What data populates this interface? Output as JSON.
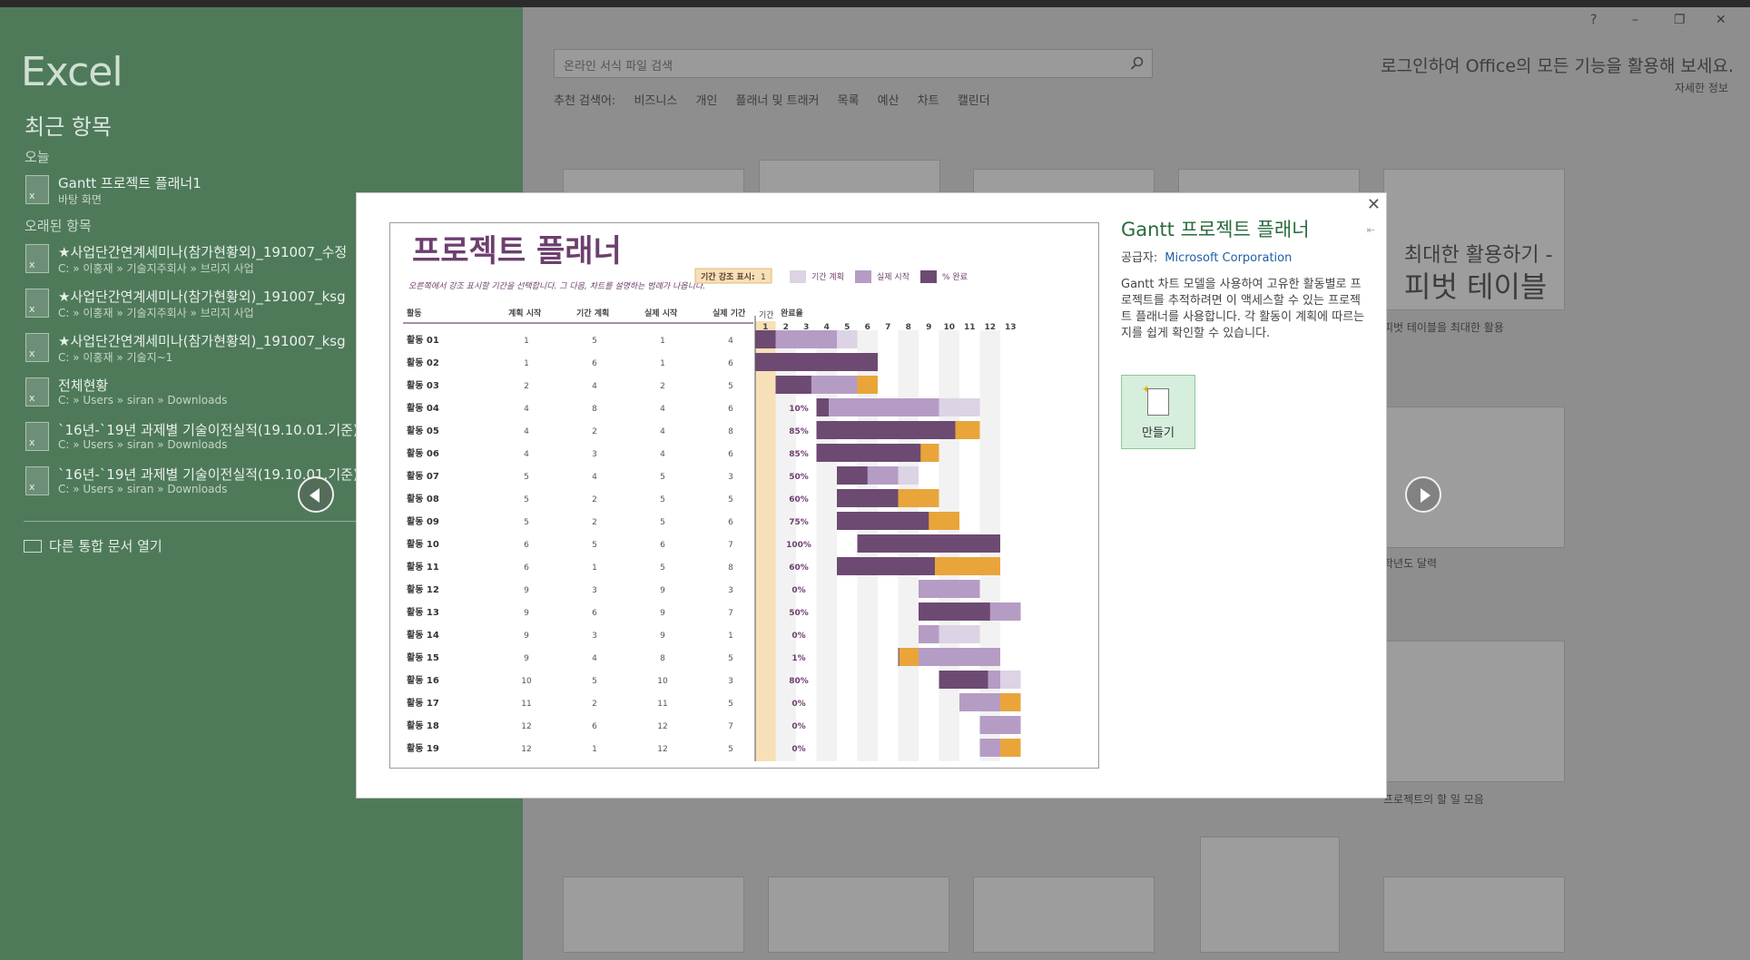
{
  "left": {
    "app_name": "Excel",
    "recent_title": "최근 항목",
    "today_label": "오늘",
    "older_label": "오래된 항목",
    "today_files": [
      {
        "name": "Gantt 프로젝트 플래너1",
        "path": "바탕 화면"
      }
    ],
    "older_files": [
      {
        "name": "★사업단간연계세미나(참가현황외)_191007_수정",
        "path": "C: » 이홍재 » 기술지주회사 » 브리지 사업"
      },
      {
        "name": "★사업단간연계세미나(참가현황외)_191007_ksg",
        "path": "C: » 이홍재 » 기술지주회사 » 브리지 사업"
      },
      {
        "name": "★사업단간연계세미나(참가현황외)_191007_ksg",
        "path": "C: » 이홍재 » 기술지~1"
      },
      {
        "name": "전체현황",
        "path": "C: » Users » siran » Downloads"
      },
      {
        "name": "`16년-`19년 과제별 기술이전실적(19.10.01.기준)_(",
        "path": "C: » Users » siran » Downloads"
      },
      {
        "name": "`16년-`19년 과제별 기술이전실적(19.10.01.기준)",
        "path": "C: » Users » siran » Downloads"
      }
    ],
    "open_other": "다른 통합 문서 열기"
  },
  "right": {
    "window_controls": [
      "?",
      "–",
      "❐",
      "✕"
    ],
    "search_placeholder": "온라인 서식 파일 검색",
    "suggested_label": "추천 검색어:",
    "suggested": [
      "비즈니스",
      "개인",
      "플래너 및 트래커",
      "목록",
      "예산",
      "차트",
      "캘린더"
    ],
    "signin": "로그인하여 Office의 모든 기능을 활용해 보세요.",
    "details": "자세한 정보",
    "tile_captions": [
      "피벗 테이블을 최대한 활용",
      "학년도 달력",
      "프로젝트의 할 일 모음"
    ],
    "pivot_tile": {
      "line1": "최대한 활용하기 -",
      "line2": "피벗 테이블"
    }
  },
  "dialog": {
    "title": "Gantt 프로젝트 플래너",
    "publisher_label": "공급자:",
    "publisher": "Microsoft Corporation",
    "description": "Gantt 차트 모델을 사용하여 고유한 활동별로 프로젝트를 추적하려면 이 액세스할 수 있는 프로젝트 플래너를 사용합니다. 각 활동이 계획에 따르는지를 쉽게 확인할 수 있습니다.",
    "create_label": "만들기",
    "close": "✕"
  },
  "planner": {
    "title": "프로젝트 플래너",
    "subtitle": "오른쪽에서 강조 표시할 기간을 선택합니다. 그 다음, 차트를 설명하는 범례가 나옵니다.",
    "highlight_label": "기간 강조 표시:",
    "highlight_value": "1",
    "legend": [
      {
        "label": "기간 계획",
        "color": "#dcd3e4"
      },
      {
        "label": "실제 시작",
        "color": "#b59cc4"
      },
      {
        "label": "% 완료",
        "color": "#6d4a72"
      }
    ],
    "period_label": "기간",
    "headers": [
      "활동",
      "계획 시작",
      "기간 계획",
      "실제 시작",
      "실제 기간",
      "완료율"
    ],
    "periods": [
      "1",
      "2",
      "3",
      "4",
      "5",
      "6",
      "7",
      "8",
      "9",
      "10",
      "11",
      "12",
      "13"
    ],
    "rows": [
      {
        "name": "활동 01",
        "plan_start": 1,
        "plan_dur": 5,
        "act_start": 1,
        "act_dur": 4,
        "pct": "25%"
      },
      {
        "name": "활동 02",
        "plan_start": 1,
        "plan_dur": 6,
        "act_start": 1,
        "act_dur": 6,
        "pct": "100%"
      },
      {
        "name": "활동 03",
        "plan_start": 2,
        "plan_dur": 4,
        "act_start": 2,
        "act_dur": 5,
        "pct": "35%"
      },
      {
        "name": "활동 04",
        "plan_start": 4,
        "plan_dur": 8,
        "act_start": 4,
        "act_dur": 6,
        "pct": "10%"
      },
      {
        "name": "활동 05",
        "plan_start": 4,
        "plan_dur": 2,
        "act_start": 4,
        "act_dur": 8,
        "pct": "85%"
      },
      {
        "name": "활동 06",
        "plan_start": 4,
        "plan_dur": 3,
        "act_start": 4,
        "act_dur": 6,
        "pct": "85%"
      },
      {
        "name": "활동 07",
        "plan_start": 5,
        "plan_dur": 4,
        "act_start": 5,
        "act_dur": 3,
        "pct": "50%"
      },
      {
        "name": "활동 08",
        "plan_start": 5,
        "plan_dur": 2,
        "act_start": 5,
        "act_dur": 5,
        "pct": "60%"
      },
      {
        "name": "활동 09",
        "plan_start": 5,
        "plan_dur": 2,
        "act_start": 5,
        "act_dur": 6,
        "pct": "75%"
      },
      {
        "name": "활동 10",
        "plan_start": 6,
        "plan_dur": 5,
        "act_start": 6,
        "act_dur": 7,
        "pct": "100%"
      },
      {
        "name": "활동 11",
        "plan_start": 6,
        "plan_dur": 1,
        "act_start": 5,
        "act_dur": 8,
        "pct": "60%"
      },
      {
        "name": "활동 12",
        "plan_start": 9,
        "plan_dur": 3,
        "act_start": 9,
        "act_dur": 3,
        "pct": "0%"
      },
      {
        "name": "활동 13",
        "plan_start": 9,
        "plan_dur": 6,
        "act_start": 9,
        "act_dur": 7,
        "pct": "50%"
      },
      {
        "name": "활동 14",
        "plan_start": 9,
        "plan_dur": 3,
        "act_start": 9,
        "act_dur": 1,
        "pct": "0%"
      },
      {
        "name": "활동 15",
        "plan_start": 9,
        "plan_dur": 4,
        "act_start": 8,
        "act_dur": 5,
        "pct": "1%"
      },
      {
        "name": "활동 16",
        "plan_start": 10,
        "plan_dur": 5,
        "act_start": 10,
        "act_dur": 3,
        "pct": "80%"
      },
      {
        "name": "활동 17",
        "plan_start": 11,
        "plan_dur": 2,
        "act_start": 11,
        "act_dur": 5,
        "pct": "0%"
      },
      {
        "name": "활동 18",
        "plan_start": 12,
        "plan_dur": 6,
        "act_start": 12,
        "act_dur": 7,
        "pct": "0%"
      },
      {
        "name": "활동 19",
        "plan_start": 12,
        "plan_dur": 1,
        "act_start": 12,
        "act_dur": 5,
        "pct": "0%"
      }
    ],
    "colors": {
      "title": "#6d3f6e",
      "plan": "#dcd3e4",
      "actual": "#b59cc4",
      "complete": "#6d4a72",
      "beyond": "#e9a53a",
      "beyond_plan": "#e2c9aa",
      "highlight": "#f7dfb8"
    }
  }
}
